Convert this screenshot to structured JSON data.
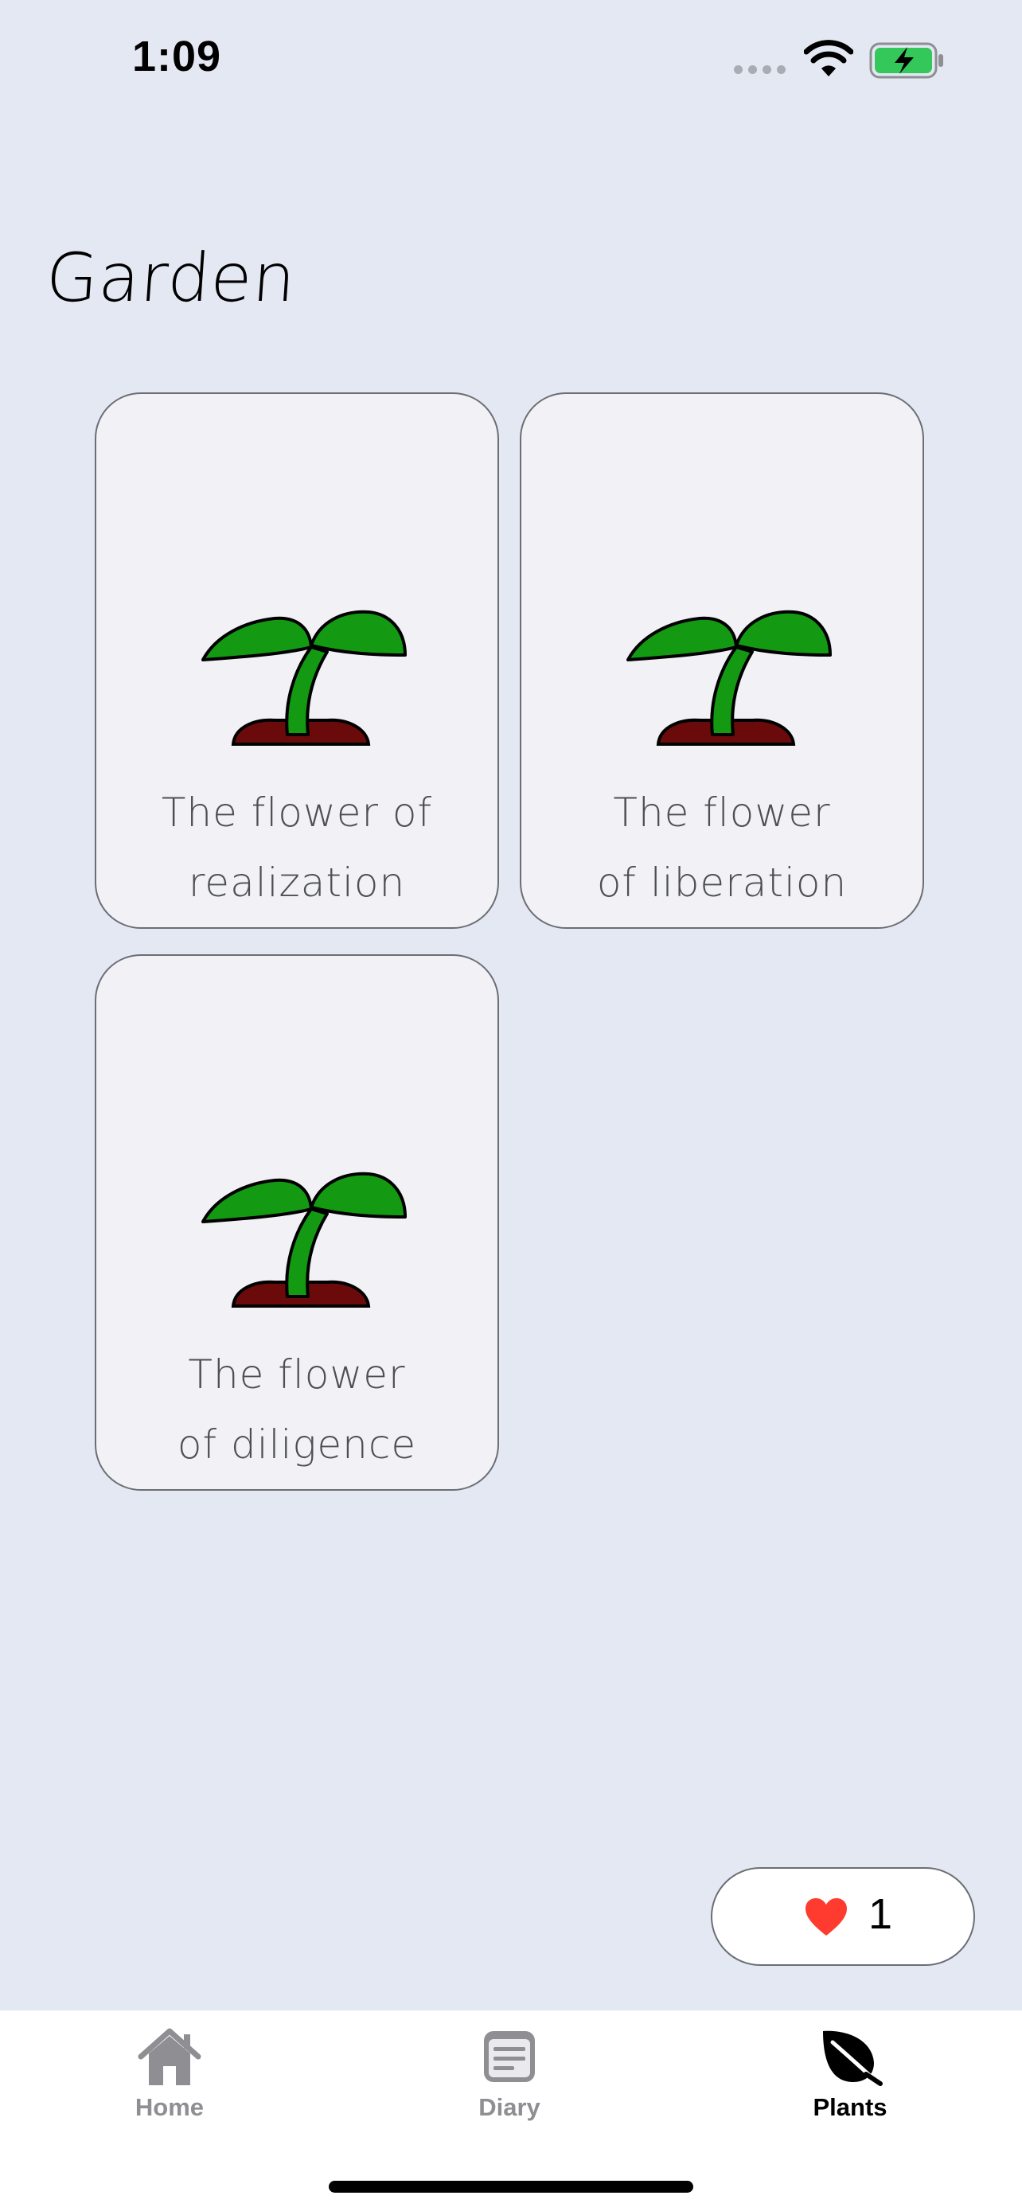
{
  "status_bar": {
    "time": "1:09"
  },
  "page": {
    "title": "Garden"
  },
  "plants": [
    {
      "line1": "The flower of",
      "line2": "realization",
      "icon": "sprout-icon"
    },
    {
      "line1": "The flower",
      "line2": "of liberation",
      "icon": "sprout-icon"
    },
    {
      "line1": "The flower",
      "line2": "of diligence",
      "icon": "sprout-icon"
    }
  ],
  "likes": {
    "count": "1",
    "icon": "heart-icon",
    "color": "#ff3b30"
  },
  "tabs": [
    {
      "label": "Home",
      "icon": "house-icon",
      "active": false
    },
    {
      "label": "Diary",
      "icon": "note-icon",
      "active": false
    },
    {
      "label": "Plants",
      "icon": "leaf-icon",
      "active": true
    }
  ],
  "colors": {
    "background": "#e4e8f3",
    "card": "#f1f1f6",
    "leaf": "#139a12",
    "soil": "#6b0a0a",
    "battery": "#34c759"
  }
}
